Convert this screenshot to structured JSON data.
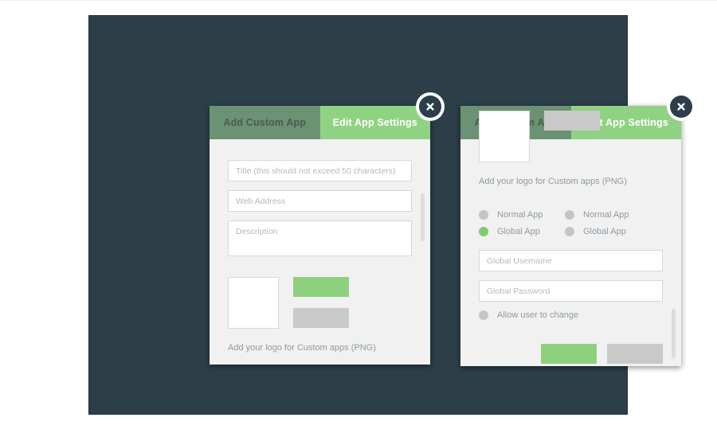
{
  "dialogs": {
    "left": {
      "tabs": [
        {
          "label": "Add Custom App",
          "active": false
        },
        {
          "label": "Edit App Settings",
          "active": true
        }
      ],
      "fields": [
        {
          "name": "title",
          "placeholder": "Title (this should not exceed 50 characters)",
          "value": ""
        },
        {
          "name": "web-address",
          "placeholder": "Web Address",
          "value": ""
        },
        {
          "name": "description",
          "placeholder": "Description",
          "value": ""
        }
      ],
      "logo_helper_text": "Add your logo for Custom apps (PNG)",
      "buttons": {
        "primary_label": "",
        "secondary_label": ""
      },
      "close_icon": "close-circle-icon"
    },
    "right": {
      "tabs": [
        {
          "label": "Add Custom App",
          "active": false
        },
        {
          "label": "Edit App Settings",
          "active": true
        }
      ],
      "logo_helper_text": "Add your logo for Custom apps (PNG)",
      "radio_groups": [
        {
          "name": "app-scope-primary",
          "options": [
            {
              "label": "Normal App",
              "selected": false
            },
            {
              "label": "Global App",
              "selected": true
            }
          ]
        },
        {
          "name": "app-scope-secondary",
          "options": [
            {
              "label": "Normal App",
              "selected": false
            },
            {
              "label": "Global App",
              "selected": false
            }
          ]
        }
      ],
      "fields": [
        {
          "name": "global-username",
          "placeholder": "Global Username",
          "value": ""
        },
        {
          "name": "global-password",
          "placeholder": "Global Password",
          "value": ""
        }
      ],
      "allow_user_to_change": {
        "label": "Allow user to change",
        "selected": false
      },
      "buttons": {
        "primary_label": "",
        "secondary_label": ""
      },
      "close_icon": "close-circle-icon"
    }
  },
  "colors": {
    "stage_background": "#2c3e48",
    "tab_active": "#90d283",
    "tab_inactive": "#6b9272",
    "panel_background": "#f1f1f1",
    "button_primary": "#8fd07f",
    "button_secondary": "#c9c9c9",
    "radio_selected": "#7ecb6e",
    "radio_unselected": "#c5c5c5",
    "helper_text": "#8d9aa3",
    "placeholder_text": "#b8b8b8"
  }
}
